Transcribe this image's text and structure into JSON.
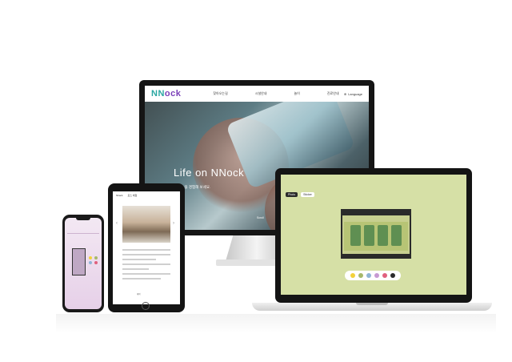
{
  "desktop": {
    "logo": "NNock",
    "nav_items": [
      "찾아오는길",
      "시설안내",
      "놀이",
      "진료안내"
    ],
    "lang": "Language",
    "hero_title": "Life on NNock",
    "hero_subtitle": "NNock을 경험해 보세요.",
    "scroll_label": "Scroll"
  },
  "laptop": {
    "tabs": [
      "Photo",
      "Sticker"
    ],
    "palette_colors": [
      "#f2d13a",
      "#a6b86a",
      "#8fb5d6",
      "#c79ad3",
      "#e0607e",
      "#2b2b2b"
    ]
  },
  "tablet": {
    "top_links": [
      "Nback",
      "로스 체험"
    ],
    "button_label": "예약"
  },
  "phone": {
    "dot_colors": [
      "#f2d13a",
      "#a6b86a",
      "#8fb5d6",
      "#e0607e"
    ]
  }
}
